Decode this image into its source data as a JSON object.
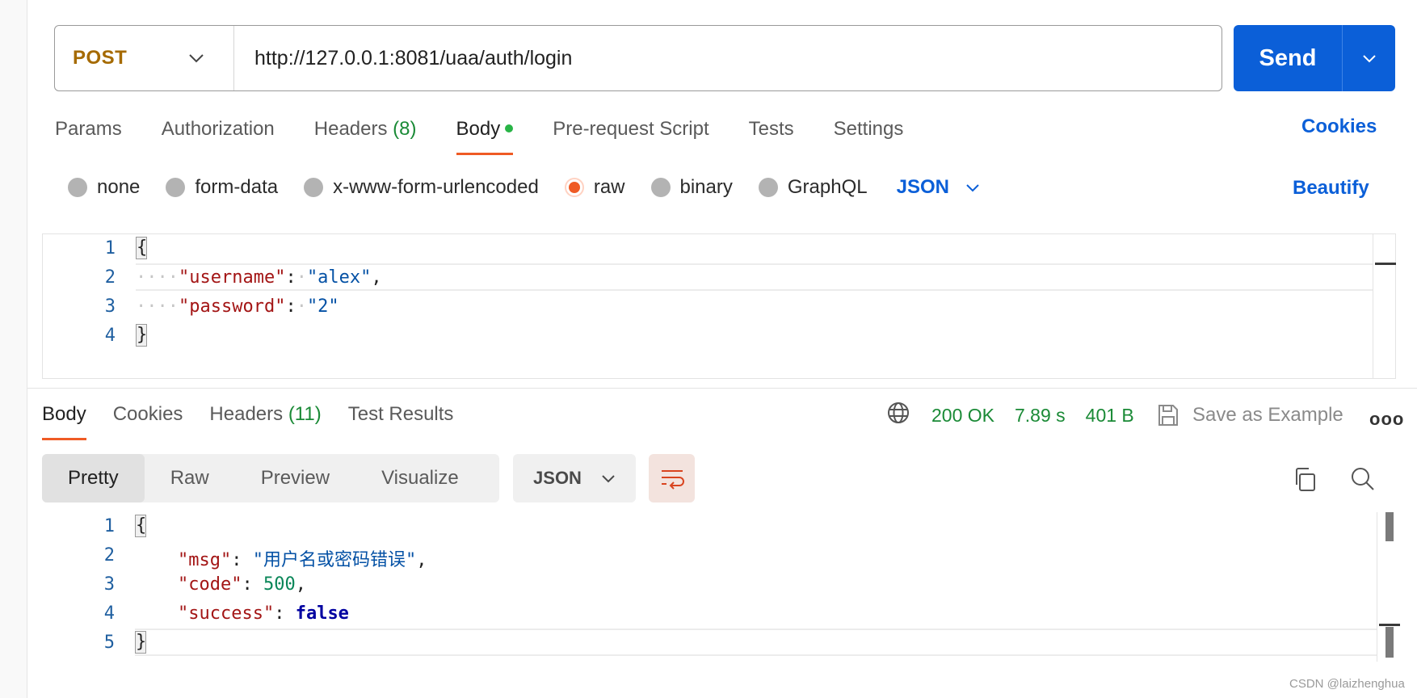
{
  "request": {
    "method": "POST",
    "url": "http://127.0.0.1:8081/uaa/auth/login",
    "send_label": "Send"
  },
  "request_tabs": [
    {
      "label": "Params",
      "count": ""
    },
    {
      "label": "Authorization",
      "count": ""
    },
    {
      "label": "Headers",
      "count": "(8)"
    },
    {
      "label": "Body",
      "count": ""
    },
    {
      "label": "Pre-request Script",
      "count": ""
    },
    {
      "label": "Tests",
      "count": ""
    },
    {
      "label": "Settings",
      "count": ""
    }
  ],
  "active_request_tab": "Body",
  "cookies_label": "Cookies",
  "body_types": [
    {
      "label": "none",
      "selected": false
    },
    {
      "label": "form-data",
      "selected": false
    },
    {
      "label": "x-www-form-urlencoded",
      "selected": false
    },
    {
      "label": "raw",
      "selected": true
    },
    {
      "label": "binary",
      "selected": false
    },
    {
      "label": "GraphQL",
      "selected": false
    }
  ],
  "raw_language": "JSON",
  "beautify_label": "Beautify",
  "request_body": {
    "line_numbers": [
      "1",
      "2",
      "3",
      "4"
    ],
    "open_brace": "{",
    "close_brace": "}",
    "fields": [
      {
        "key": "\"username\"",
        "value": "\"alex\"",
        "trailing": ","
      },
      {
        "key": "\"password\"",
        "value": "\"2\"",
        "trailing": ""
      }
    ]
  },
  "response_tabs": [
    {
      "label": "Body",
      "count": ""
    },
    {
      "label": "Cookies",
      "count": ""
    },
    {
      "label": "Headers",
      "count": "(11)"
    },
    {
      "label": "Test Results",
      "count": ""
    }
  ],
  "active_response_tab": "Body",
  "response_meta": {
    "status": "200 OK",
    "time": "7.89 s",
    "size": "401 B",
    "save_example_label": "Save as Example",
    "more_label": "ooo"
  },
  "view_modes": [
    {
      "label": "Pretty",
      "active": true
    },
    {
      "label": "Raw",
      "active": false
    },
    {
      "label": "Preview",
      "active": false
    },
    {
      "label": "Visualize",
      "active": false
    }
  ],
  "response_format": "JSON",
  "response_body": {
    "line_numbers": [
      "1",
      "2",
      "3",
      "4",
      "5"
    ],
    "open_brace": "{",
    "close_brace": "}",
    "msg_key": "\"msg\"",
    "msg_value": "\"用户名或密码错误\"",
    "code_key": "\"code\"",
    "code_value": "500",
    "success_key": "\"success\"",
    "success_value": "false"
  },
  "watermark": "CSDN @laizhenghua",
  "colors": {
    "accent_blue": "#0b5fd8",
    "method_post": "#a56a00",
    "active_tab_underline": "#ef5b25",
    "status_green": "#1a8a36"
  },
  "icons": {
    "method_dropdown": "chevron-down-icon",
    "send_dropdown": "chevron-down-icon",
    "status": "globe-icon",
    "save": "save-icon",
    "wrap": "wrap-lines-icon",
    "copy": "copy-icon",
    "search": "search-icon"
  }
}
